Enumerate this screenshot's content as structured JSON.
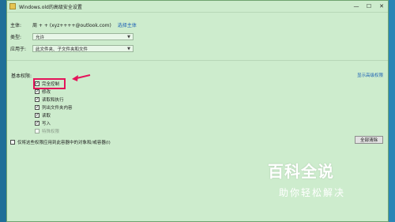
{
  "window": {
    "title": "Windows.old的高级安全设置",
    "controls": {
      "minimize": "—",
      "maximize": "☐",
      "close": "✕"
    }
  },
  "principal": {
    "label": "主体:",
    "value": "周 + + (xyz++++@outlook.com)",
    "select_link": "选择主体"
  },
  "type": {
    "label": "类型:",
    "selected": "允许"
  },
  "applies_to": {
    "label": "应用于:",
    "selected": "此文件夹、子文件夹和文件"
  },
  "basic_permissions": {
    "label": "基本权限:",
    "show_advanced_link": "显示高级权限",
    "items": [
      {
        "label": "完全控制",
        "checked": true,
        "disabled": false
      },
      {
        "label": "修改",
        "checked": true,
        "disabled": false
      },
      {
        "label": "读取和执行",
        "checked": true,
        "disabled": false
      },
      {
        "label": "列出文件夹内容",
        "checked": true,
        "disabled": false
      },
      {
        "label": "读取",
        "checked": true,
        "disabled": false
      },
      {
        "label": "写入",
        "checked": true,
        "disabled": false
      },
      {
        "label": "特殊权限",
        "checked": false,
        "disabled": true
      }
    ]
  },
  "apply_only": {
    "label": "仅将这些权限应用到此容器中的对象和/或容器(I)",
    "checked": false
  },
  "clear_all_button": "全部清除",
  "watermark": {
    "brand": "百科全说",
    "tagline": "助你轻松解决"
  },
  "colors": {
    "window_bg": "#cdeccd",
    "highlight": "#e4145a",
    "link": "#1a5fb4"
  }
}
